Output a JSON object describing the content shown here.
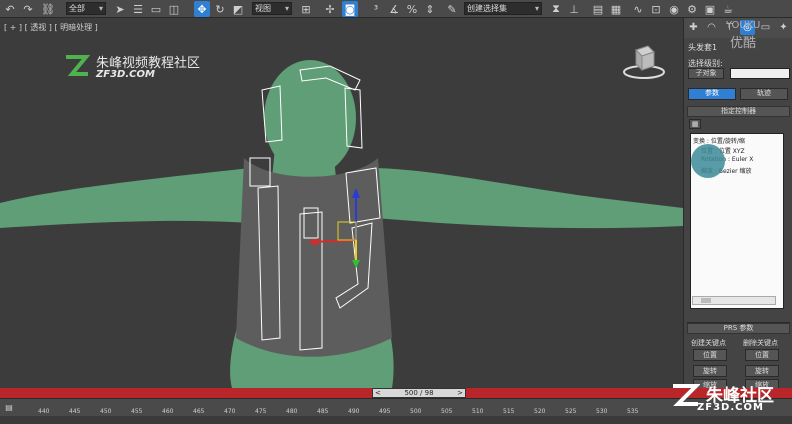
{
  "toolbar": {
    "selection_filter": "全部",
    "reference_coord": "视图",
    "named_selection": "创建选择集",
    "icons": [
      "undo-icon",
      "redo-icon",
      "link-icon",
      "unlink-icon",
      "bind-spacewarp-icon",
      "select-filter",
      "select-object-icon",
      "select-by-name-icon",
      "rect-select-icon",
      "window-crossing-icon",
      "select-move-icon",
      "select-rotate-icon",
      "select-scale-icon",
      "ref-coord",
      "pivot-icon",
      "select-manipulate-icon",
      "keyboard-shortcut-icon",
      "snap-3-icon",
      "angle-snap-icon",
      "percent-snap-icon",
      "spinner-snap-icon",
      "edit-named-sel-icon",
      "named-selection",
      "mirror-icon",
      "align-icon",
      "layer-icon",
      "graphite-icon",
      "curve-editor-icon",
      "schematic-icon",
      "material-editor-icon",
      "render-setup-icon",
      "render-frame-icon",
      "render-icon"
    ]
  },
  "viewport": {
    "label": "[ + ] [ 透视 ] [ 明暗处理 ]",
    "brand_cn": "朱峰视频教程社区",
    "brand_en": "ZF3D.COM"
  },
  "panel": {
    "stack_label": "头发套1",
    "select_level_label": "选择级别:",
    "sub_object_btn": "子对象",
    "tab_params": "参数",
    "tab_track": "轨迹",
    "rollout_assign": "指定控制器",
    "tree": [
      "变换 : 位置/旋转/缩",
      "位置 : 位置 XYZ",
      "Rotation : Euler X",
      "缩放 : Bezier 缩放"
    ],
    "rollout_prs": "PRS 参数",
    "create_key": "创建关键点",
    "delete_key": "删除关键点",
    "btn_pos_a": "位置",
    "btn_rot_a": "旋转",
    "btn_scl_a": "缩放",
    "btn_pos_b": "位置",
    "btn_rot_b": "旋转",
    "btn_scl_b": "缩放"
  },
  "watermarks": {
    "youku_en": "YOUKU",
    "youku_cn": "优酷",
    "zf_cn": "朱峰社区",
    "zf_en": "ZF3D.COM"
  },
  "timeline": {
    "slider_label": "500 / 98",
    "prev": "<",
    "next": ">",
    "ticks": [
      "440",
      "445",
      "450",
      "455",
      "460",
      "465",
      "470",
      "475",
      "480",
      "485",
      "490",
      "495",
      "500",
      "505",
      "510",
      "515",
      "520",
      "525",
      "530",
      "535"
    ]
  },
  "colors": {
    "accent": "#2f7fd3",
    "timeline_red": "#b8262a",
    "skin": "#5f9e77",
    "vest": "#5d5d5d"
  }
}
